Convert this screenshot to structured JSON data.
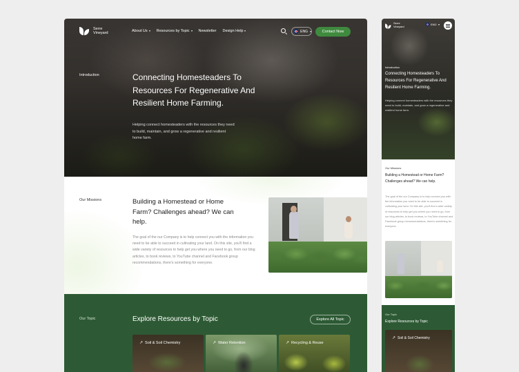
{
  "brand": {
    "name": "Serre Vineyard"
  },
  "nav": {
    "items": [
      {
        "label": "About Us"
      },
      {
        "label": "Resources by Topic"
      },
      {
        "label": "Newsletter"
      },
      {
        "label": "Design Help"
      }
    ],
    "language": "ENG",
    "cta": "Contact Now"
  },
  "hero": {
    "section_label": "Introduction",
    "title": "Connecting Homesteaders To Resources For Regenerative And Resilient Home Farming.",
    "description": "Helping connect homesteaders with the resources they need to build, maintain, and grow a regenerative and resilient home farm."
  },
  "missions": {
    "section_label": "Our Missions",
    "title": "Building a Homestead or Home Farm? Challenges ahead? We can help.",
    "body": "The goal of the our Company is to help connect you with the information you need to be able to succeed in cultivating your land. On this site, you'll find a wide variety of resources to help get you where you need to go, from our blog articles, to book reviews, to YouTube channel and Facebook group recommendations, there's something for everyone."
  },
  "topics": {
    "section_label": "Our Topic",
    "title": "Explore Resources by Topic",
    "explore_button": "Explore All Topic",
    "cards": [
      {
        "label": "Soil & Soil Chemistry",
        "icon": "arrow-up-right-icon"
      },
      {
        "label": "Water Retention",
        "icon": "arrow-up-right-icon"
      },
      {
        "label": "Recycling & Reuse",
        "icon": "arrow-up-right-icon"
      }
    ]
  },
  "colors": {
    "accent": "#3f8a3f",
    "topics_bg": "#2d5a34"
  }
}
